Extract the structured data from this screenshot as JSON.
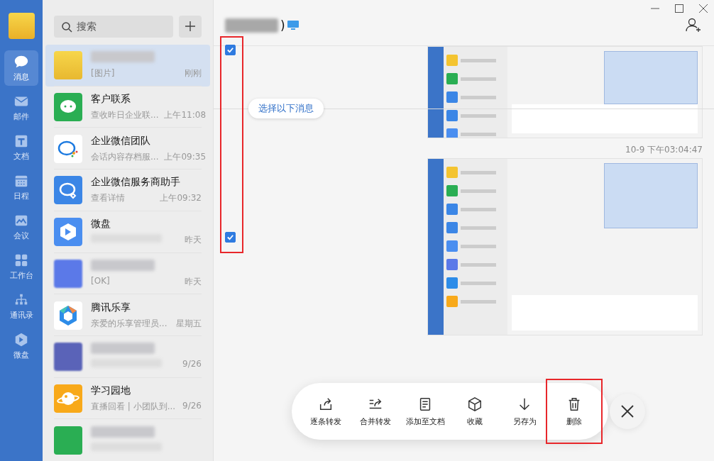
{
  "nav": {
    "items": [
      {
        "kind": "chat",
        "label": "消息",
        "selected": true
      },
      {
        "kind": "mail",
        "label": "邮件",
        "selected": false
      },
      {
        "kind": "doc",
        "label": "文档",
        "selected": false
      },
      {
        "kind": "calendar",
        "label": "日程",
        "selected": false
      },
      {
        "kind": "meeting",
        "label": "会议",
        "selected": false
      },
      {
        "kind": "apps",
        "label": "工作台",
        "selected": false
      },
      {
        "kind": "contacts",
        "label": "通讯录",
        "selected": false
      },
      {
        "kind": "drive",
        "label": "微盘",
        "selected": false
      }
    ]
  },
  "search": {
    "placeholder": "搜索"
  },
  "chats": [
    {
      "kind": "photo",
      "preview": "[图片]",
      "time": "刚刚",
      "selected": true
    },
    {
      "kind": "wechat",
      "name": "客户联系",
      "preview": "查收昨日企业联...",
      "time": "上午11:08",
      "selected": false
    },
    {
      "kind": "team",
      "name": "企业微信团队",
      "preview": "会话内容存档服...",
      "time": "上午09:35",
      "selected": false
    },
    {
      "kind": "helper",
      "name": "企业微信服务商助手",
      "preview": "查看详情",
      "time": "上午09:32",
      "selected": false
    },
    {
      "kind": "drive",
      "name": "微盘",
      "time": "昨天",
      "selected": false
    },
    {
      "kind": "company",
      "preview": "[OK]",
      "time": "昨天",
      "selected": false
    },
    {
      "kind": "lexiang",
      "name": "腾讯乐享",
      "preview": "亲爱的乐享管理员...",
      "time": "星期五",
      "selected": false
    },
    {
      "kind": "blurred",
      "time": "9/26",
      "selected": false
    },
    {
      "kind": "planet",
      "name": "学习园地",
      "preview": "直播回看 | 小团队到...",
      "time": "9/26",
      "selected": false
    },
    {
      "kind": "green",
      "selected": false
    }
  ],
  "conversation": {
    "title": ")",
    "checkbox_column_outlined": true,
    "select_below": "选择以下消息",
    "messages": [
      {
        "kind": "screenshot",
        "checked": true
      },
      {
        "kind": "screenshot",
        "time": "10-9 下午03:04:47",
        "checked": true
      }
    ]
  },
  "toolbar": {
    "actions": [
      {
        "kind": "forward",
        "label": "逐条转发",
        "outlined": false
      },
      {
        "kind": "merge",
        "label": "合并转发",
        "outlined": false
      },
      {
        "kind": "doc",
        "label": "添加至文档",
        "outlined": false
      },
      {
        "kind": "box",
        "label": "收藏",
        "outlined": false
      },
      {
        "kind": "download",
        "label": "另存为",
        "outlined": false
      },
      {
        "kind": "trash",
        "label": "删除",
        "outlined": true
      }
    ]
  }
}
